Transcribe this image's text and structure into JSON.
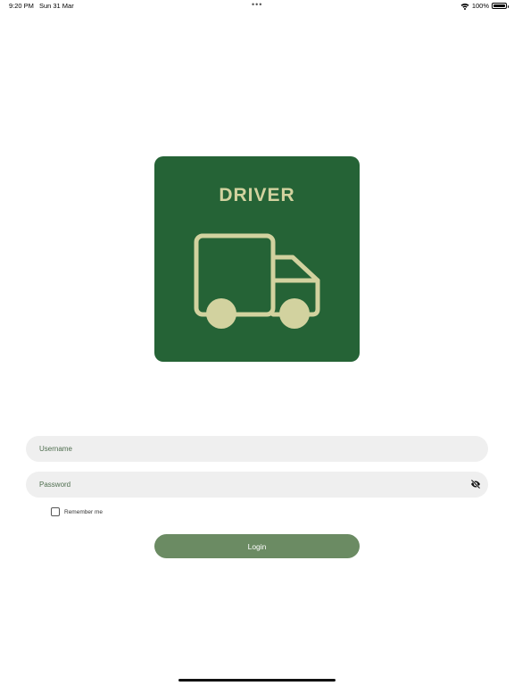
{
  "status_bar": {
    "time": "9:20 PM",
    "date": "Sun 31 Mar",
    "battery_text": "100%",
    "battery_level": 1.0,
    "wifi_icon": "wifi-icon"
  },
  "logo": {
    "title": "DRIVER",
    "icon": "truck-icon",
    "background_color": "#256336",
    "accent_color": "#d2d29f"
  },
  "form": {
    "username": {
      "placeholder": "Username",
      "value": ""
    },
    "password": {
      "placeholder": "Password",
      "value": "",
      "toggle_icon": "eye-off-icon"
    },
    "remember_label": "Remember me",
    "remember_checked": false,
    "login_label": "Login",
    "login_color": "#6b8b63"
  }
}
